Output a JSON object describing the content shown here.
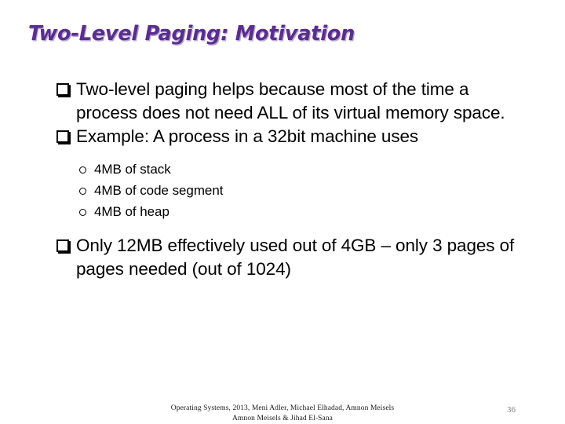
{
  "slide": {
    "title": "Two-Level Paging: Motivation",
    "title_color": "#5B2D8E",
    "title_shadow_color": "#B9A7DA",
    "background_color": "#FFFFFF",
    "text_color": "#000000",
    "bullets": [
      {
        "level": 1,
        "marker": "hollow-square-bullet",
        "text": "Two-level paging helps because most of the time a process does not need ALL of its virtual memory space."
      },
      {
        "level": 1,
        "marker": "hollow-square-bullet",
        "text": "Example: A process in a 32bit machine uses"
      },
      {
        "level": 2,
        "marker": "hollow-circle-bullet",
        "text": "4MB of stack"
      },
      {
        "level": 2,
        "marker": "hollow-circle-bullet",
        "text": "4MB of code segment"
      },
      {
        "level": 2,
        "marker": "hollow-circle-bullet",
        "text": "4MB of heap"
      },
      {
        "level": 1,
        "marker": "hollow-square-bullet",
        "text": "Only 12MB effectively used out of 4GB – only 3 pages of pages needed (out of 1024)"
      }
    ],
    "footer": {
      "line1": "Operating Systems, 2013, Meni Adler, Michael Elhadad, Amnon Meisels",
      "line2": "Amnon Meisels  & Jihad El-Sana",
      "color": "#1A1A1A"
    },
    "page_number": "36",
    "page_number_color": "#808080"
  }
}
